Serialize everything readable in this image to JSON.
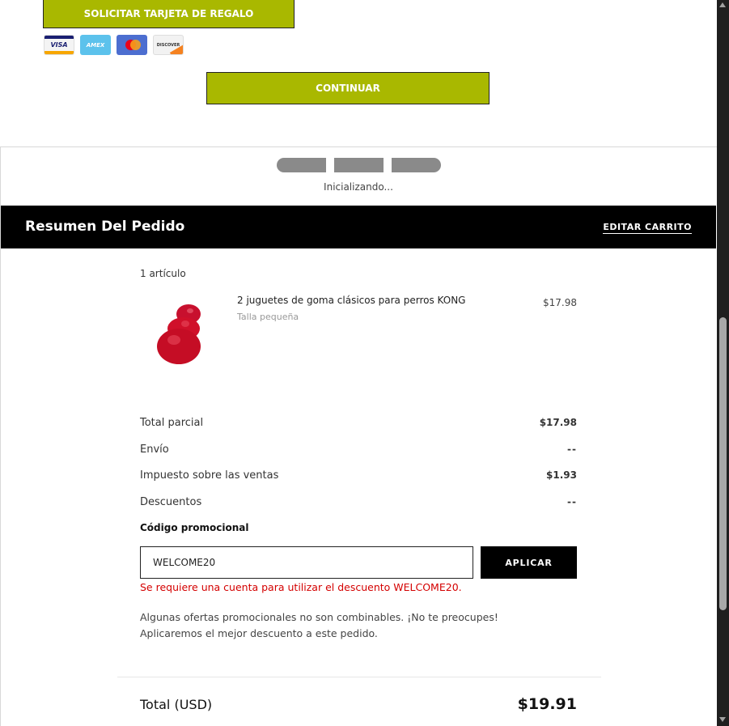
{
  "payment": {
    "gift_card_button": "SOLICITAR TARJETA DE REGALO",
    "cards": [
      {
        "icon": "visa-card-icon",
        "label": "VISA"
      },
      {
        "icon": "amex-card-icon",
        "label": "AMEX"
      },
      {
        "icon": "mastercard-icon",
        "label": ""
      },
      {
        "icon": "discover-card-icon",
        "label": "DISCOVER"
      }
    ],
    "continue_button": "CONTINUAR"
  },
  "loading": {
    "text": "Inicializando..."
  },
  "summary": {
    "title": "Resumen Del Pedido",
    "edit_cart": "EDITAR CARRITO",
    "item_count": "1 artículo",
    "item": {
      "name": "2 juguetes de goma clásicos para perros KONG",
      "variant": "Talla pequeña",
      "price": "$17.98",
      "image_color": "#d0102a"
    },
    "subtotal": {
      "label": "Total parcial",
      "value": "$17.98"
    },
    "shipping": {
      "label": "Envío",
      "value": "--"
    },
    "tax": {
      "label": "Impuesto sobre las ventas",
      "value": "$1.93"
    },
    "discounts": {
      "label": "Descuentos",
      "value": "--"
    },
    "promo": {
      "label": "Código promocional",
      "value": "WELCOME20",
      "apply_button": "APLICAR",
      "error": "Se requiere una cuenta para utilizar el descuento WELCOME20.",
      "note": "Algunas ofertas promocionales no son combinables. ¡No te preocupes! Aplicaremos el mejor descuento a este pedido."
    },
    "total": {
      "label": "Total (USD)",
      "value": "$19.91"
    }
  },
  "colors": {
    "accent": "#a9b800",
    "error": "#d40000",
    "header_bg": "#000000"
  }
}
